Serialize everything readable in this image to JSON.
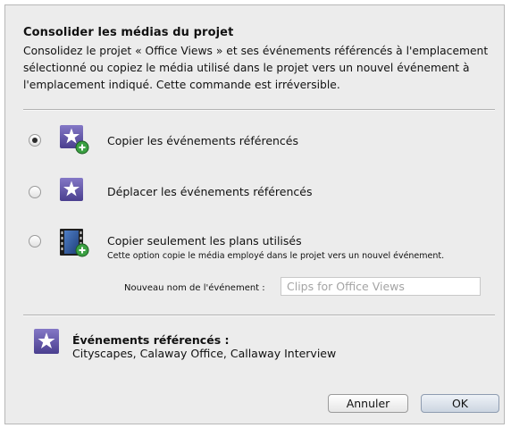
{
  "dialog": {
    "title": "Consolider les médias du projet",
    "description": "Consolidez le projet « Office Views » et ses événements référencés à l'emplacement sélectionné ou copiez le média utilisé dans le projet vers un nouvel événement à l'emplacement indiqué. Cette commande est irréversible."
  },
  "options": [
    {
      "label": "Copier les événements référencés",
      "selected": true,
      "icon": "star-plus-icon"
    },
    {
      "label": "Déplacer les événements référencés",
      "selected": false,
      "icon": "star-icon"
    },
    {
      "label": "Copier seulement les plans utilisés",
      "selected": false,
      "icon": "film-plus-icon",
      "sublabel": "Cette option copie le média employé dans le projet vers un nouvel événement."
    }
  ],
  "new_event": {
    "label": "Nouveau nom de l'événement :",
    "placeholder": "Clips for Office Views"
  },
  "referenced": {
    "title": "Événements référencés :",
    "list": "Cityscapes, Calaway Office, Callaway Interview",
    "icon": "star-icon"
  },
  "buttons": {
    "cancel": "Annuler",
    "ok": "OK"
  },
  "colors": {
    "icon_purple": "#5b4fa3",
    "plus_green": "#3aa042",
    "dialog_bg": "#ececec"
  }
}
